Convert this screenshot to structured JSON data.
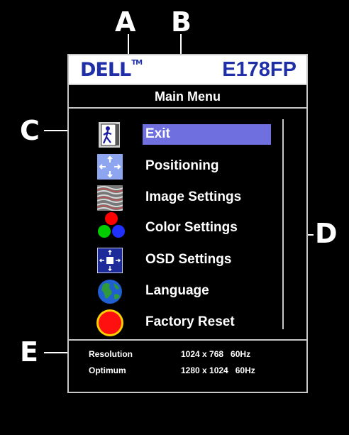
{
  "callouts": {
    "a": "A",
    "b": "B",
    "c": "C",
    "d": "D",
    "e": "E"
  },
  "header": {
    "brand": "DELL",
    "trademark": "TM",
    "model": "E178FP"
  },
  "menu": {
    "title": "Main Menu",
    "items": [
      {
        "label": "Exit",
        "icon": "exit-icon",
        "selected": true
      },
      {
        "label": "Positioning",
        "icon": "positioning-icon"
      },
      {
        "label": "Image Settings",
        "icon": "image-settings-icon"
      },
      {
        "label": "Color Settings",
        "icon": "color-settings-icon"
      },
      {
        "label": "OSD Settings",
        "icon": "osd-settings-icon"
      },
      {
        "label": "Language",
        "icon": "globe-icon"
      },
      {
        "label": "Factory Reset",
        "icon": "factory-reset-icon"
      }
    ]
  },
  "footer": {
    "resolution_label": "Resolution",
    "resolution_value": "1024 x 768   60Hz",
    "optimum_label": "Optimum",
    "optimum_value": "1280 x 1024   60Hz"
  },
  "colors": {
    "highlight": "#6f6fe0",
    "brand": "#1f2fa8",
    "frame": "#c7c7c7"
  }
}
